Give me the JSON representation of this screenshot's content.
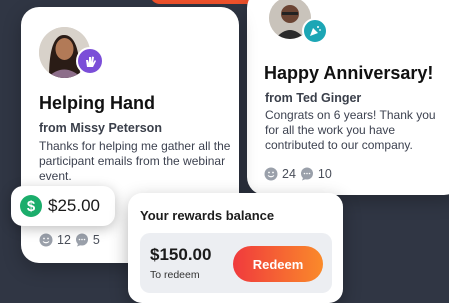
{
  "colors": {
    "background": "#303644",
    "accent_orange": "#f0522c",
    "badge_purple": "#7b4ed8",
    "badge_teal": "#1ca6b5",
    "money_green": "#1bad6b",
    "redeem_gradient_start": "#f03a3d",
    "redeem_gradient_end": "#fa8a2a"
  },
  "left_card": {
    "avatar": "avatar-woman",
    "badge_icon": "waving-hand-icon",
    "title": "Helping Hand",
    "from": "from Missy Peterson",
    "message": "Thanks for helping me gather all the participant emails from the webinar event.",
    "amount": "$25.00",
    "amount_icon": "dollar-icon",
    "smiles": "12",
    "comments": "5"
  },
  "right_card": {
    "avatar": "avatar-man",
    "badge_icon": "party-popper-icon",
    "title": "Happy Anniversary!",
    "from": "from Ted Ginger",
    "message": "Congrats on 6 years! Thank you for all the work you have contributed to our company.",
    "smiles": "24",
    "comments": "10"
  },
  "rewards": {
    "title": "Your rewards balance",
    "balance": "$150.00",
    "balance_sub": "To redeem",
    "redeem_label": "Redeem"
  }
}
